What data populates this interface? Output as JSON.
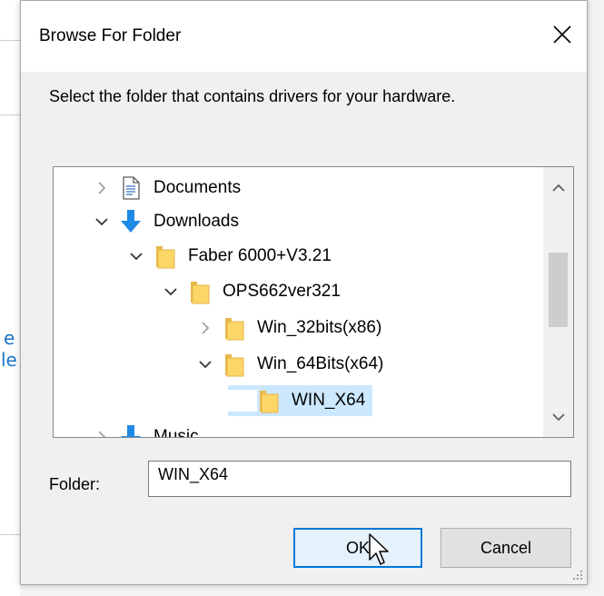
{
  "dialog": {
    "title": "Browse For Folder",
    "instruction": "Select the folder that contains drivers for your hardware."
  },
  "background": {
    "fragment_top": "e",
    "fragment_bottom": "le"
  },
  "tree": {
    "items": [
      {
        "label": "Documents",
        "expander": "collapsed",
        "icon": "documents-icon",
        "selected": false
      },
      {
        "label": "Downloads",
        "expander": "expanded",
        "icon": "downloads-icon",
        "selected": false
      },
      {
        "label": "Faber 6000+V3.21",
        "expander": "expanded",
        "icon": "folder-icon",
        "selected": false
      },
      {
        "label": "OPS662ver321",
        "expander": "expanded",
        "icon": "folder-icon",
        "selected": false
      },
      {
        "label": "Win_32bits(x86)",
        "expander": "collapsed",
        "icon": "folder-icon",
        "selected": false
      },
      {
        "label": "Win_64Bits(x64)",
        "expander": "expanded",
        "icon": "folder-icon",
        "selected": false
      },
      {
        "label": "WIN_X64",
        "expander": "none",
        "icon": "folder-icon",
        "selected": true
      },
      {
        "label": "Music",
        "expander": "collapsed",
        "icon": "music-icon",
        "selected": false
      }
    ]
  },
  "folder": {
    "label": "Folder:",
    "value": "WIN_X64"
  },
  "buttons": {
    "ok": "OK",
    "cancel": "Cancel"
  },
  "colors": {
    "accent": "#0078d7",
    "selection": "#cce8ff",
    "folder": "#fcd667",
    "download_arrow": "#1e8ae6"
  }
}
